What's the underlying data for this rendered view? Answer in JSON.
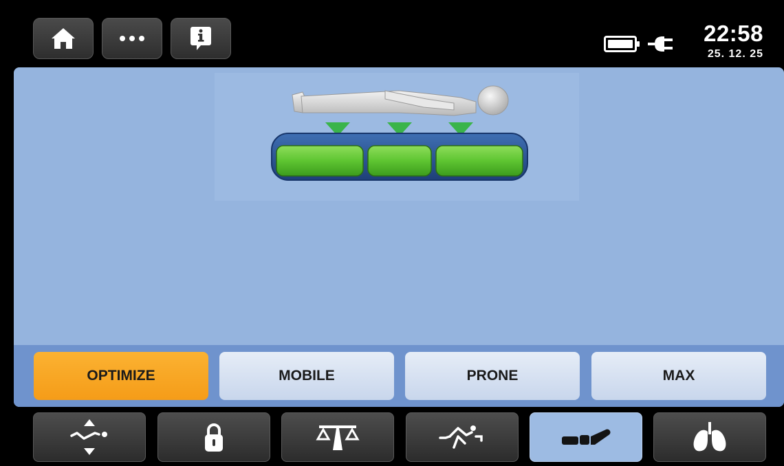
{
  "header": {
    "buttons": [
      {
        "icon": "home-icon"
      },
      {
        "icon": "more-icon"
      },
      {
        "icon": "info-icon"
      }
    ],
    "status": {
      "battery_icon": "battery-icon",
      "power_icon": "plug-icon",
      "time": "22:58",
      "date": "25. 12. 25"
    }
  },
  "modes": {
    "selected": "OPTIMIZE",
    "items": [
      {
        "label": "OPTIMIZE",
        "active": true
      },
      {
        "label": "MOBILE",
        "active": false
      },
      {
        "label": "PRONE",
        "active": false
      },
      {
        "label": "MAX",
        "active": false
      }
    ]
  },
  "nav": {
    "items": [
      {
        "icon": "bed-position-icon",
        "active": false
      },
      {
        "icon": "lock-icon",
        "active": false
      },
      {
        "icon": "scale-icon",
        "active": false
      },
      {
        "icon": "bed-exit-icon",
        "active": false
      },
      {
        "icon": "mattress-icon",
        "active": true
      },
      {
        "icon": "lungs-icon",
        "active": false
      }
    ]
  },
  "colors": {
    "accent_active": "#f8a524",
    "main_background": "#95b4de",
    "mattress_green": "#5ec531",
    "pressure_arrow": "#3ab44a"
  }
}
